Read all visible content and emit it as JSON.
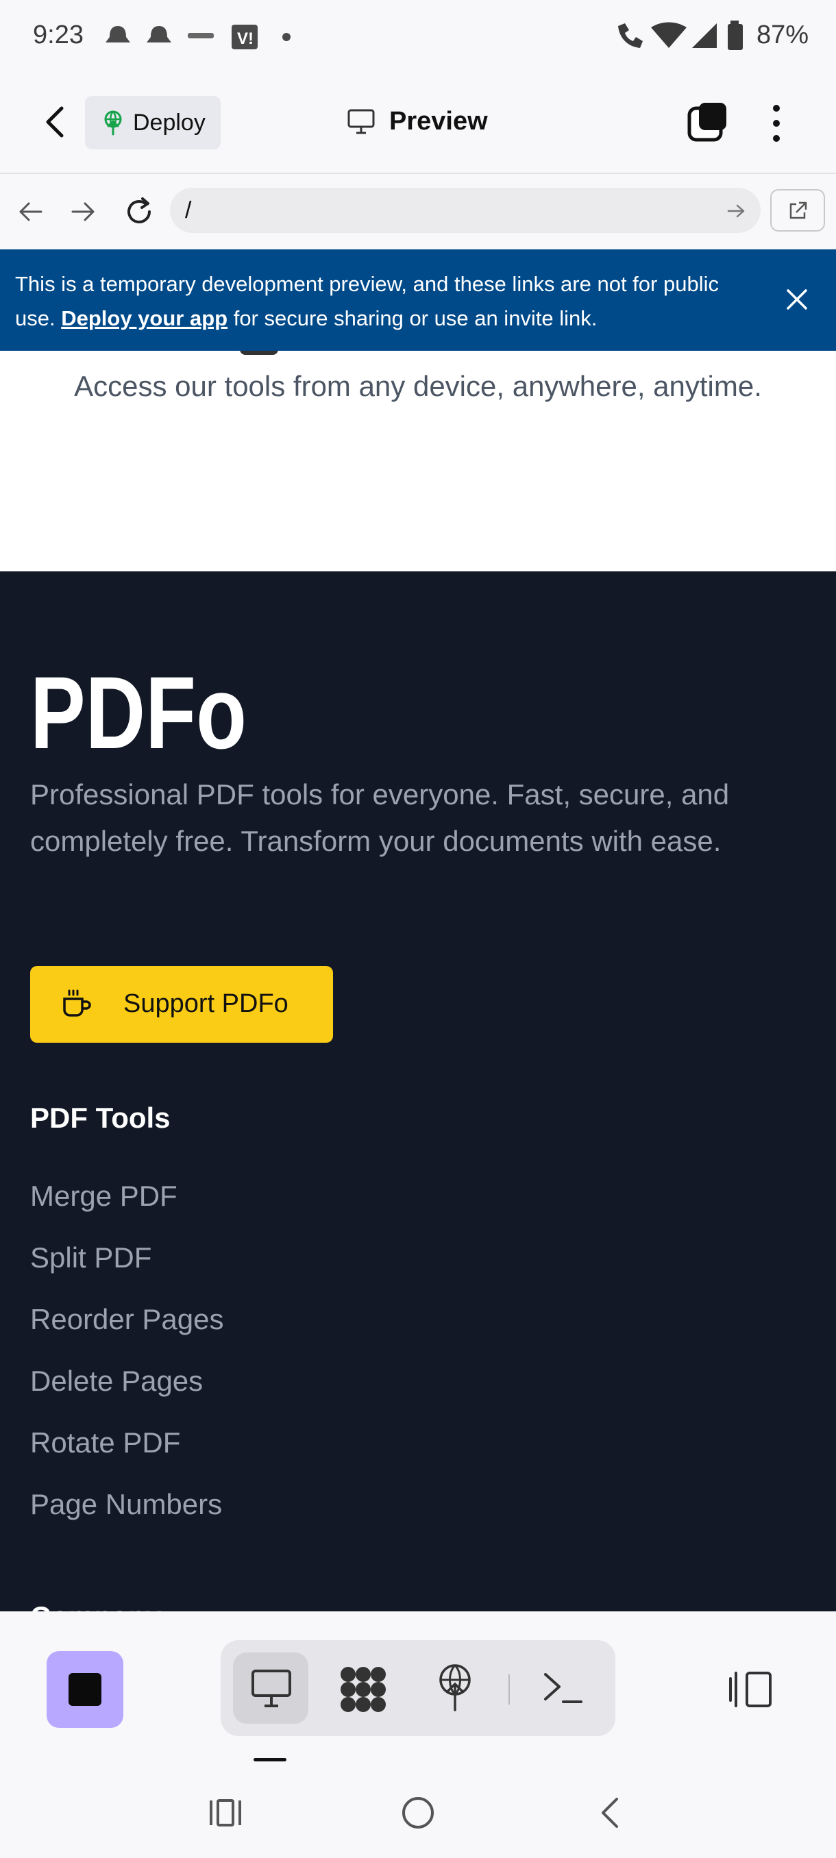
{
  "status_bar": {
    "time": "9:23",
    "battery": "87%"
  },
  "header": {
    "deploy_label": "Deploy",
    "preview_label": "Preview"
  },
  "browser": {
    "url": "/"
  },
  "banner": {
    "text_before": "This is a temporary development preview, and these links are not for public use. ",
    "link_text": "Deploy your app",
    "text_after": " for secure sharing or use an invite link."
  },
  "page": {
    "hero_subtext": "Access our tools from any device, anywhere, anytime.",
    "footer": {
      "logo_text": "PDFo",
      "description": "Professional PDF tools for everyone. Fast, secure, and completely free. Transform your documents with ease.",
      "support_label": "Support PDFo",
      "tools_heading": "PDF Tools",
      "tools": [
        "Merge PDF",
        "Split PDF",
        "Reorder Pages",
        "Delete Pages",
        "Rotate PDF",
        "Page Numbers"
      ],
      "company_heading": "Company"
    }
  },
  "colors": {
    "banner_bg": "#004a8a",
    "footer_bg": "#121826",
    "support_button": "#facc15",
    "stop_button": "#b9a8ff"
  },
  "icons": [
    "back-chevron-icon",
    "deploy-icon",
    "monitor-icon",
    "tabs-icon",
    "more-vert-icon",
    "arrow-left-icon",
    "arrow-right-icon",
    "reload-icon",
    "go-arrow-icon",
    "external-link-icon",
    "close-icon",
    "coffee-icon",
    "webview-icon",
    "workflow-icon",
    "deploy-globe-icon",
    "terminal-icon",
    "layout-icon",
    "recents-icon",
    "home-icon",
    "system-back-icon"
  ]
}
